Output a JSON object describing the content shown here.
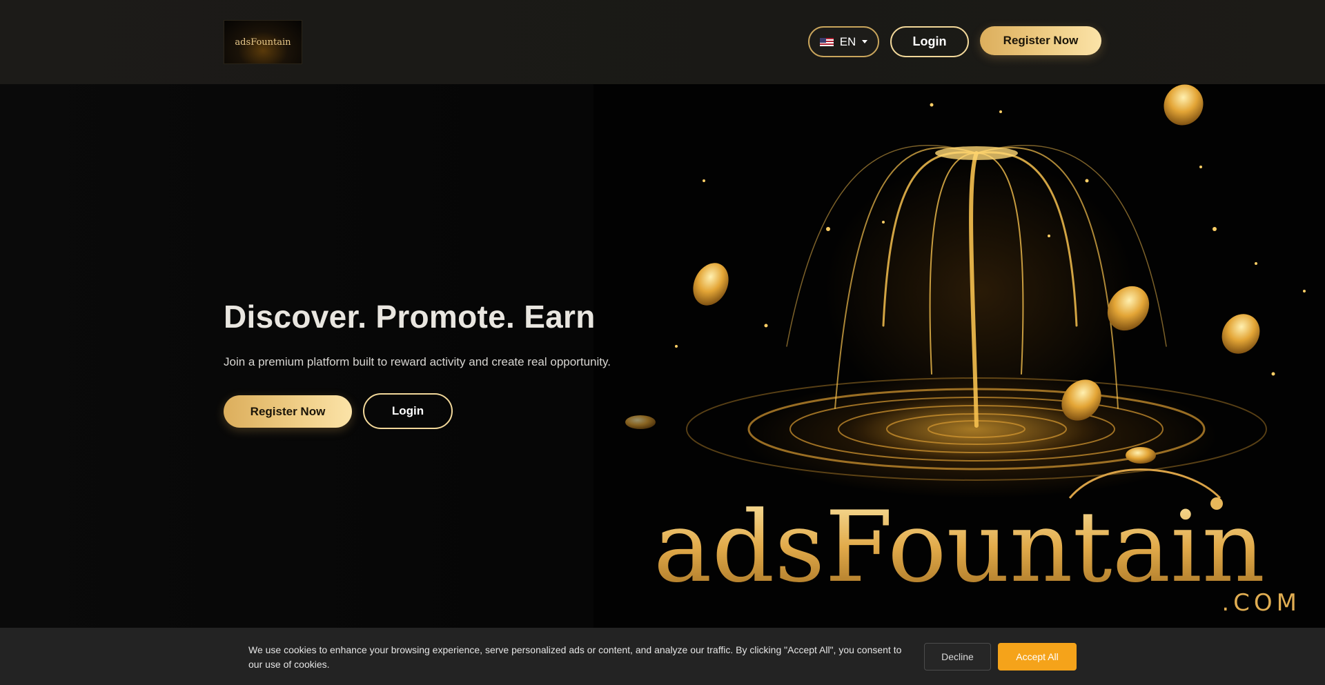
{
  "header": {
    "logo_text": "adsFountain",
    "language": {
      "code": "EN",
      "flag_icon": "us-flag-icon"
    },
    "login_label": "Login",
    "register_label": "Register Now"
  },
  "hero": {
    "title": "Discover. Promote. Earn",
    "subtitle": "Join a premium platform built to reward activity and create real opportunity.",
    "register_label": "Register Now",
    "login_label": "Login",
    "art_brand": "adsFountain",
    "art_domain": ".COM"
  },
  "cookie_banner": {
    "message": "We use cookies to enhance your browsing experience, serve personalized ads or content, and analyze our traffic. By clicking \"Accept All\", you consent to our use of cookies.",
    "decline_label": "Decline",
    "accept_label": "Accept All"
  },
  "colors": {
    "gold_accent": "#f0cf88",
    "gold_border": "#f2d89a",
    "cookie_accept": "#f5a31a",
    "header_bg": "#1c1b18",
    "cookie_bg": "#232323"
  }
}
